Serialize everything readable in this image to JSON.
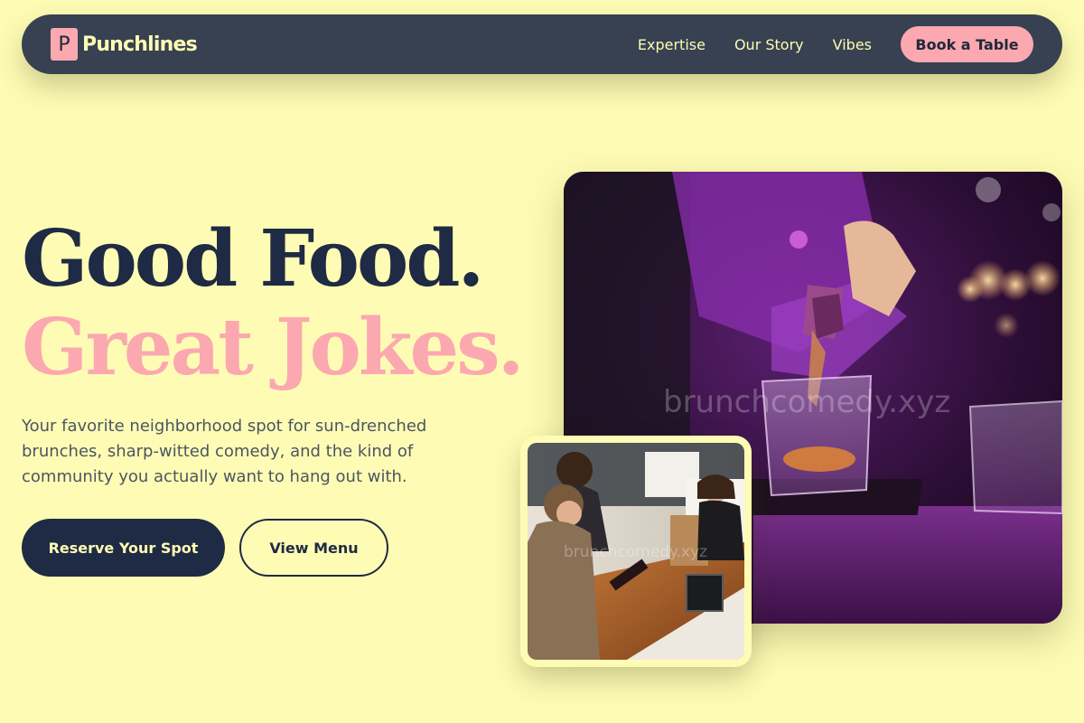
{
  "nav": {
    "logo_letter": "P",
    "brand": "Punchlines",
    "links": [
      "Expertise",
      "Our Story",
      "Vibes"
    ],
    "cta": "Book a Table"
  },
  "hero": {
    "headline_1": "Good Food.",
    "headline_2": "Great Jokes.",
    "lead": "Your favorite neighborhood spot for sun-drenched brunches, sharp-witted comedy, and the kind of community you actually want to hang out with.",
    "primary_button": "Reserve Your Spot",
    "secondary_button": "View Menu"
  },
  "images": {
    "main_watermark": "brunchcomedy.xyz",
    "small_watermark": "brunchcomedy.xyz"
  },
  "colors": {
    "background": "#fefcb4",
    "nav": "#374151",
    "accent_pink": "#fba8b0",
    "navy": "#1f2a44"
  }
}
